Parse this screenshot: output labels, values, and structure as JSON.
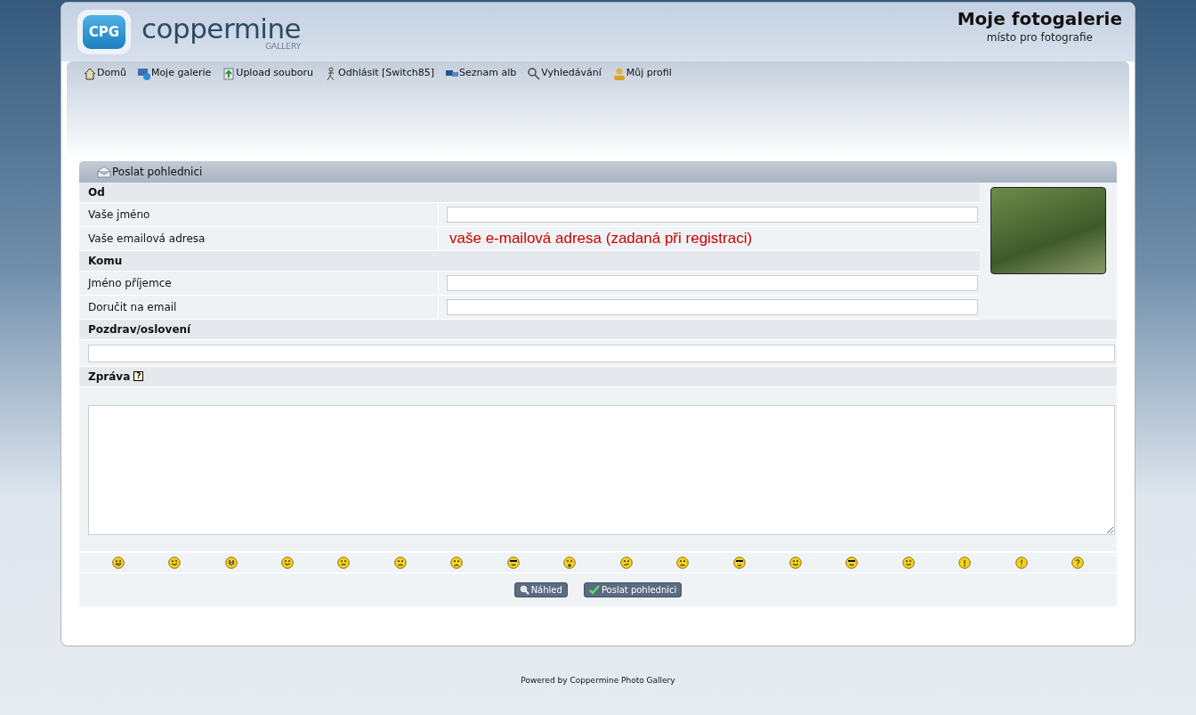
{
  "logo": {
    "badge": "CPG",
    "name": "coppermine",
    "sub": "GALLERY"
  },
  "site": {
    "title": "Moje fotogalerie",
    "tagline": "místo pro fotografie"
  },
  "nav": [
    {
      "kind": "home",
      "label": "Domů"
    },
    {
      "kind": "gallery",
      "label": "Moje galerie"
    },
    {
      "kind": "upload",
      "label": "Upload souboru"
    },
    {
      "kind": "logout",
      "label": "Odhlásit [Switch85]"
    },
    {
      "kind": "albums",
      "label": "Seznam alb"
    },
    {
      "kind": "search",
      "label": "Vyhledávání"
    },
    {
      "kind": "profile",
      "label": "Můj profil"
    }
  ],
  "form": {
    "title": "Poslat pohlednici",
    "rows": [
      {
        "kind": "section",
        "label": "Od"
      },
      {
        "kind": "input",
        "label": "Vaše jméno"
      },
      {
        "kind": "note",
        "label": "Vaše emailová adresa",
        "value": "vaše e-mailová adresa (zadaná při registraci)"
      },
      {
        "kind": "section",
        "label": "Komu"
      },
      {
        "kind": "input",
        "label": "Jméno příjemce"
      },
      {
        "kind": "input",
        "label": "Doručit na email"
      }
    ],
    "greeting": {
      "label": "Pozdrav/oslovení"
    },
    "message": {
      "label": "Zpráva",
      "help": "?"
    },
    "smileys": [
      {
        "kind": "grin"
      },
      {
        "kind": "tongue"
      },
      {
        "kind": "laugh"
      },
      {
        "kind": "smile"
      },
      {
        "kind": "neutral"
      },
      {
        "kind": "sad"
      },
      {
        "kind": "cry"
      },
      {
        "kind": "cool"
      },
      {
        "kind": "shock"
      },
      {
        "kind": "confused"
      },
      {
        "kind": "worried"
      },
      {
        "kind": "eyes"
      },
      {
        "kind": "squint"
      },
      {
        "kind": "cool"
      },
      {
        "kind": "wink"
      },
      {
        "kind": "idea"
      },
      {
        "kind": "exclaim"
      },
      {
        "kind": "question"
      }
    ],
    "buttons": [
      {
        "kind": "preview",
        "label": "Náhled"
      },
      {
        "kind": "send",
        "label": "Poslat pohlednici"
      }
    ]
  },
  "footer": "Powered by Coppermine Photo Gallery"
}
